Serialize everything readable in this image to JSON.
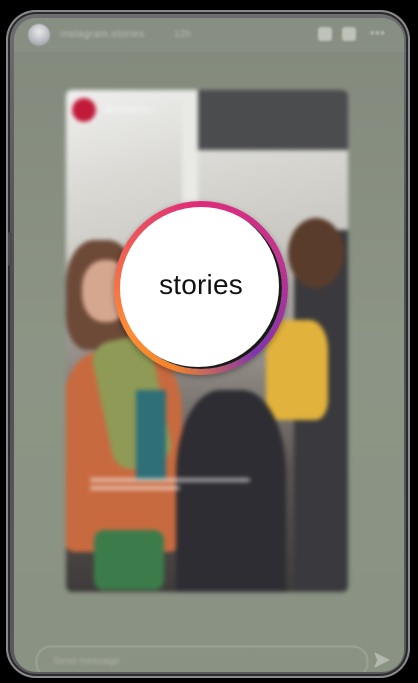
{
  "story_header": {
    "username": "instagram.stories",
    "timestamp": "12h",
    "pause_icon": "pause-icon",
    "mute_icon": "speaker-icon",
    "more_icon": "more-horizontal-icon",
    "more_glyph": "•••"
  },
  "shared_post": {
    "badge_text": "@instagram"
  },
  "stories_badge": {
    "label": "stories",
    "ring_colors": [
      "#f58529",
      "#dd2a7b",
      "#8134af"
    ]
  },
  "reply": {
    "placeholder": "Send message",
    "send_icon": "send-icon"
  },
  "colors": {
    "screen_background": "#8a9283",
    "frame": "#5a5a5e"
  }
}
